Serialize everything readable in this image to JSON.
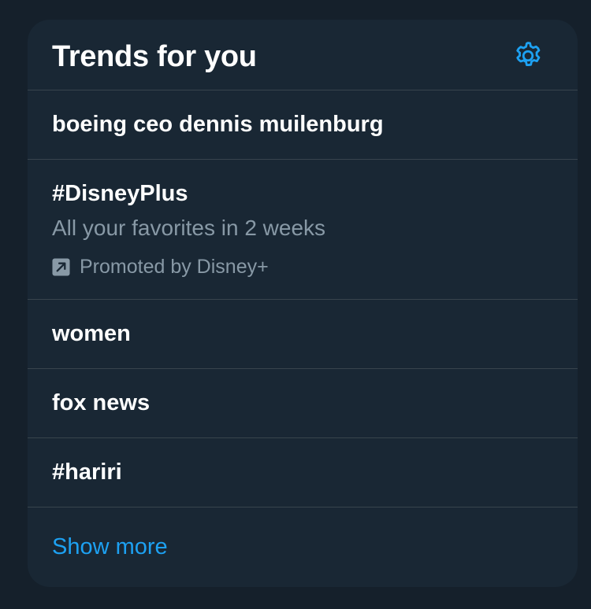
{
  "card": {
    "title": "Trends for you",
    "settings_icon": "gear-icon"
  },
  "trends": [
    {
      "name": "boeing ceo dennis muilenburg"
    },
    {
      "name": "#DisneyPlus",
      "description": "All your favorites in 2 weeks",
      "promoted_label": "Promoted by Disney+",
      "promoted_icon": "promoted-arrow-icon"
    },
    {
      "name": "women"
    },
    {
      "name": "fox news"
    },
    {
      "name": "#hariri"
    }
  ],
  "show_more_label": "Show more",
  "colors": {
    "page_background": "#15202b",
    "card_background": "#192734",
    "divider": "#38444d",
    "primary_text": "#ffffff",
    "secondary_text": "#8899a6",
    "accent": "#1da1f2"
  }
}
